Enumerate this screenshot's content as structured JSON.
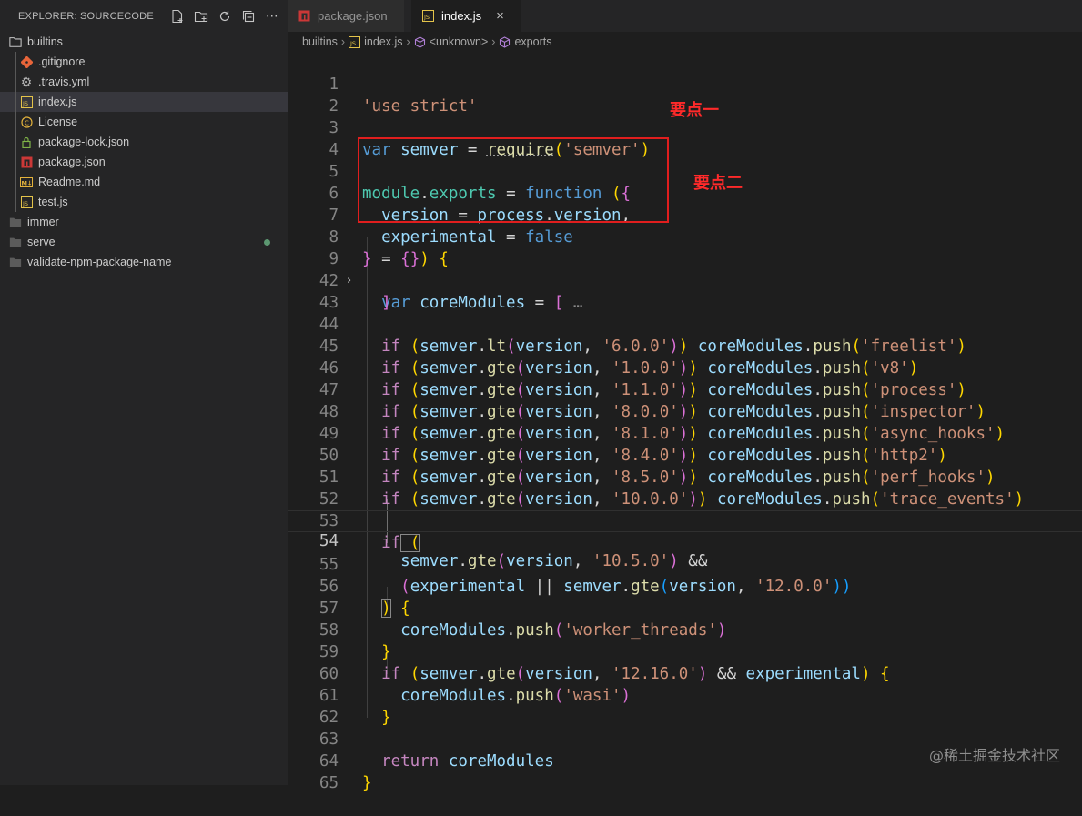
{
  "explorer": {
    "title": "EXPLORER: SOURCECODE",
    "actions": [
      "new-file-icon",
      "new-folder-icon",
      "refresh-icon",
      "collapse-all-icon",
      "more-icon"
    ],
    "items": [
      {
        "label": "builtins",
        "type": "folder-open"
      },
      {
        "label": ".gitignore",
        "type": "git"
      },
      {
        "label": ".travis.yml",
        "type": "gear"
      },
      {
        "label": "index.js",
        "type": "js"
      },
      {
        "label": "License",
        "type": "license"
      },
      {
        "label": "package-lock.json",
        "type": "lock"
      },
      {
        "label": "package.json",
        "type": "npm"
      },
      {
        "label": "Readme.md",
        "type": "md"
      },
      {
        "label": "test.js",
        "type": "js"
      },
      {
        "label": "immer",
        "type": "folder"
      },
      {
        "label": "serve",
        "type": "folder"
      },
      {
        "label": "validate-npm-package-name",
        "type": "folder"
      }
    ]
  },
  "tabs": [
    {
      "label": "package.json",
      "icon": "npm-icon"
    },
    {
      "label": "index.js",
      "icon": "js-icon",
      "close": "×"
    }
  ],
  "breadcrumb": {
    "folder": "builtins",
    "file": "index.js",
    "scope": "<unknown>",
    "symbol": "exports"
  },
  "editor": {
    "fold_placeholder": "…",
    "lines": [
      {
        "n": "1"
      },
      {
        "n": "2"
      },
      {
        "n": "3"
      },
      {
        "n": "4"
      },
      {
        "n": "5"
      },
      {
        "n": "6"
      },
      {
        "n": "7"
      },
      {
        "n": "8"
      },
      {
        "n": "9"
      },
      {
        "n": "42"
      },
      {
        "n": "43"
      },
      {
        "n": "44"
      },
      {
        "n": "45"
      },
      {
        "n": "46"
      },
      {
        "n": "47"
      },
      {
        "n": "48"
      },
      {
        "n": "49"
      },
      {
        "n": "50"
      },
      {
        "n": "51"
      },
      {
        "n": "52"
      },
      {
        "n": "53"
      },
      {
        "n": "54"
      },
      {
        "n": "55"
      },
      {
        "n": "56"
      },
      {
        "n": "57"
      },
      {
        "n": "58"
      },
      {
        "n": "59"
      },
      {
        "n": "60"
      },
      {
        "n": "61"
      },
      {
        "n": "62"
      },
      {
        "n": "63"
      },
      {
        "n": "64"
      },
      {
        "n": "65"
      }
    ],
    "tokens": {
      "l1": [
        "'use strict'"
      ],
      "l3": [
        "var",
        " semver",
        " = ",
        "require",
        "(",
        "'semver'",
        ")"
      ],
      "l5": [
        "module",
        ".",
        "exports",
        " = ",
        "function",
        " (",
        "{"
      ],
      "l6": [
        "version",
        " = ",
        "process",
        ".",
        "version",
        ","
      ],
      "l7": [
        "experimental",
        " = ",
        "false"
      ],
      "l8": [
        "}",
        " = ",
        "{}",
        ")",
        " {"
      ],
      "l9": [
        "var",
        " coreModules",
        " = ",
        "["
      ],
      "l42": [
        "]"
      ],
      "push_lines": [
        {
          "fn": "lt",
          "ver": "'6.0.0'",
          "mod": "'freelist'"
        },
        {
          "fn": "gte",
          "ver": "'1.0.0'",
          "mod": "'v8'"
        },
        {
          "fn": "gte",
          "ver": "'1.1.0'",
          "mod": "'process'"
        },
        {
          "fn": "gte",
          "ver": "'8.0.0'",
          "mod": "'inspector'"
        },
        {
          "fn": "gte",
          "ver": "'8.1.0'",
          "mod": "'async_hooks'"
        },
        {
          "fn": "gte",
          "ver": "'8.4.0'",
          "mod": "'http2'"
        },
        {
          "fn": "gte",
          "ver": "'8.5.0'",
          "mod": "'perf_hooks'"
        },
        {
          "fn": "gte",
          "ver": "'10.0.0'",
          "mod": "'trace_events'"
        }
      ],
      "l53": [
        "if",
        " ("
      ],
      "l54": [
        "semver",
        ".",
        "gte",
        "(",
        "version",
        ", ",
        "'10.5.0'",
        ")",
        " &&"
      ],
      "l55": [
        "(",
        "experimental",
        " || ",
        "semver",
        ".",
        "gte",
        "(",
        "version",
        ", ",
        "'12.0.0'",
        "))"
      ],
      "l56": [
        ")",
        " {"
      ],
      "l57": [
        "coreModules",
        ".",
        "push",
        "(",
        "'worker_threads'",
        ")"
      ],
      "l58": [
        "}"
      ],
      "l59": [
        "if",
        " (",
        "semver",
        ".",
        "gte",
        "(",
        "version",
        ", ",
        "'12.16.0'",
        ")",
        " && ",
        "experimental",
        ")",
        " {"
      ],
      "l60": [
        "coreModules",
        ".",
        "push",
        "(",
        "'wasi'",
        ")"
      ],
      "l61": [
        "}"
      ],
      "l63": [
        "return",
        " coreModules"
      ],
      "l64": [
        "}"
      ]
    },
    "current_line": "54"
  },
  "annotations": {
    "point_one": "要点一",
    "point_two": "要点二"
  },
  "watermark": "@稀土掘金技术社区",
  "colors": {
    "annotation_red": "#e01e1e",
    "background": "#1e1e1e",
    "sidebar": "#252526",
    "selection": "#37373d"
  }
}
